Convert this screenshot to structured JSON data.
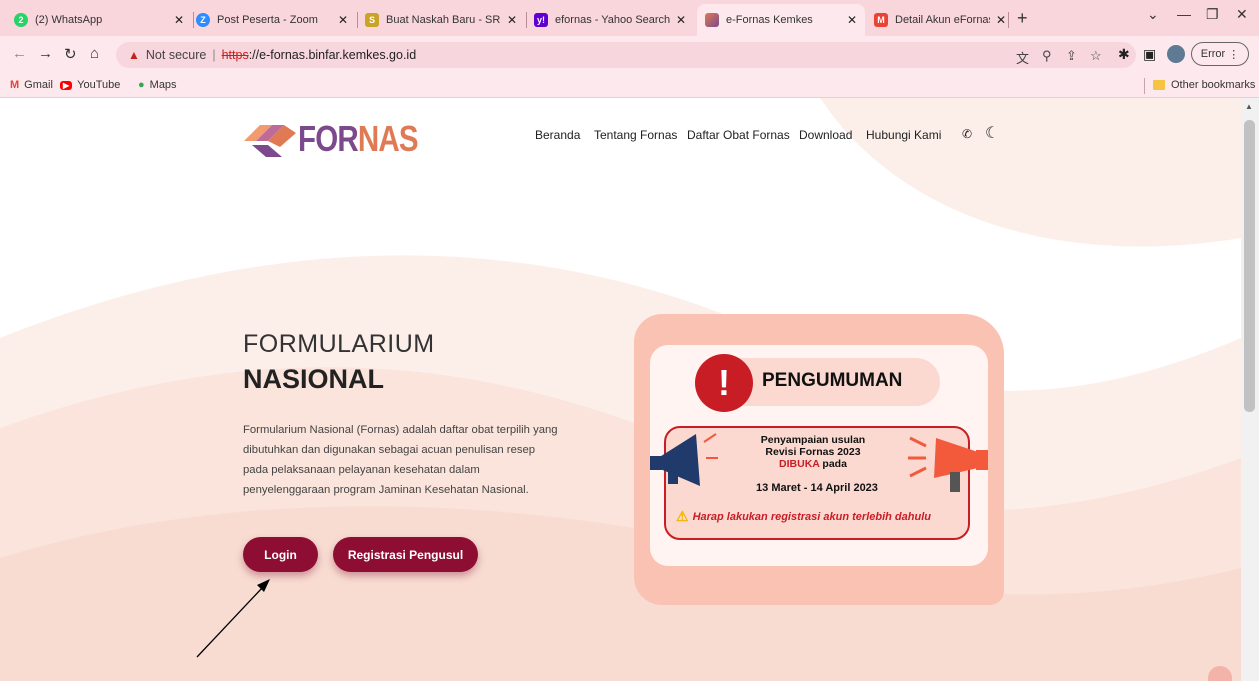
{
  "browser": {
    "tabs": [
      {
        "title": "(2) WhatsApp",
        "icon": "whatsapp-icon",
        "badge": "2",
        "color": "#25d366"
      },
      {
        "title": "Post Peserta - Zoom",
        "icon": "zoom-icon",
        "badge": "Z",
        "color": "#2d8cff"
      },
      {
        "title": "Buat Naskah Baru - SRIKANDI",
        "icon": "srikandi-icon",
        "badge": "S",
        "color": "#c9a227"
      },
      {
        "title": "efornas - Yahoo Search Results",
        "icon": "yahoo-icon",
        "badge": "y!",
        "color": "#6001d2"
      },
      {
        "title": "e-Fornas Kemkes",
        "icon": "fornas-icon",
        "badge": "",
        "color": "#d95f7a"
      },
      {
        "title": "Detail Akun eFornas Anda",
        "icon": "gmail-icon",
        "badge": "M",
        "color": "#ea4335"
      }
    ],
    "address": {
      "security_label": "Not secure",
      "scheme": "https",
      "host": "://e-fornas.binfar.kemkes.go.id"
    },
    "error_label": "Error",
    "bookmarks": [
      {
        "label": "Gmail",
        "icon": "gmail-icon"
      },
      {
        "label": "YouTube",
        "icon": "youtube-icon"
      },
      {
        "label": "Maps",
        "icon": "maps-icon"
      }
    ],
    "other_bookmarks": "Other bookmarks"
  },
  "site": {
    "logo": {
      "part1": "FOR",
      "part2": "NAS"
    },
    "nav": [
      "Beranda",
      "Tentang Fornas",
      "Daftar Obat Fornas",
      "Download",
      "Hubungi Kami"
    ],
    "hero": {
      "title_line1": "FORMULARIUM",
      "title_line2": "NASIONAL",
      "description": "Formularium Nasional (Fornas) adalah daftar obat terpilih yang dibutuhkan dan digunakan sebagai acuan penulisan resep pada pelaksanaan pelayanan kesehatan dalam penyelenggaraan program Jaminan Kesehatan Nasional.",
      "login_label": "Login",
      "register_label": "Registrasi Pengusul"
    },
    "announcement": {
      "heading": "PENGUMUMAN",
      "line1": "Penyampaian usulan",
      "line2": "Revisi Fornas 2023",
      "line3_highlight": "DIBUKA",
      "line3_rest": "pada",
      "date_range": "13 Maret - 14 April 2023",
      "warning": "Harap lakukan registrasi akun terlebih dahulu"
    }
  },
  "colors": {
    "brand_button": "#8e0d33",
    "announcement_red": "#c81d25",
    "card_salmon": "#f9c2b2"
  }
}
